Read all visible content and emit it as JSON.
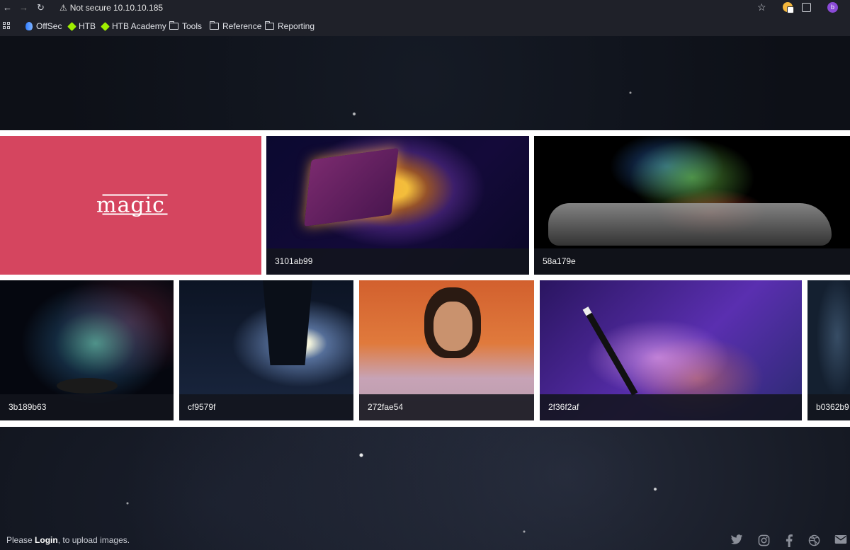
{
  "browser": {
    "security_label": "Not secure",
    "url": "10.10.10.185",
    "profile_initial": "b"
  },
  "bookmarks": [
    {
      "label": "OffSec",
      "icon": "offsec-icon"
    },
    {
      "label": "HTB",
      "icon": "htb-cube-icon"
    },
    {
      "label": "HTB Academy",
      "icon": "htb-cube-icon"
    },
    {
      "label": "Tools",
      "icon": "folder-icon"
    },
    {
      "label": "Reference",
      "icon": "folder-icon"
    },
    {
      "label": "Reporting",
      "icon": "folder-icon"
    }
  ],
  "gallery": {
    "logo_text": "magic",
    "row1": [
      {
        "caption": "3101ab99",
        "image": "glowing-spellbook"
      },
      {
        "caption": "58a179e",
        "image": "hand-with-colored-smoke"
      }
    ],
    "row2": [
      {
        "caption": "3b189b63",
        "image": "top-hat-sparkles"
      },
      {
        "caption": "cf9579f",
        "image": "hand-holding-galaxy"
      },
      {
        "caption": "272fae54",
        "image": "man-magic-gesture"
      },
      {
        "caption": "2f36f2af",
        "image": "magic-wand-sparks"
      },
      {
        "caption": "b0362b9",
        "image": "partial-starfield"
      }
    ]
  },
  "footer": {
    "prefix": "Please ",
    "login_link": "Login",
    "suffix": ", to upload images.",
    "social_icons": [
      "twitter-icon",
      "instagram-icon",
      "facebook-icon",
      "dribbble-icon",
      "email-icon"
    ]
  },
  "colors": {
    "chrome_bg": "#1f2129",
    "logo_tile": "#d5455f",
    "caption_bg": "#12141c"
  }
}
